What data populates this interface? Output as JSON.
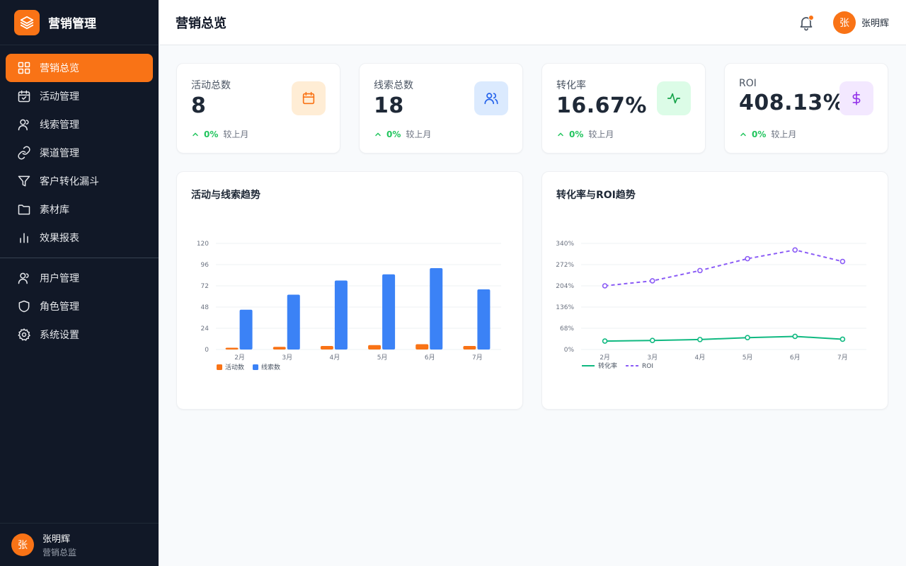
{
  "brand": {
    "name": "营销管理"
  },
  "sidebar": {
    "items": [
      {
        "label": "营销总览",
        "icon": "dashboard-icon",
        "active": true
      },
      {
        "label": "活动管理",
        "icon": "calendar-check-icon"
      },
      {
        "label": "线索管理",
        "icon": "user-icon"
      },
      {
        "label": "渠道管理",
        "icon": "link-icon"
      },
      {
        "label": "客户转化漏斗",
        "icon": "funnel-icon"
      },
      {
        "label": "素材库",
        "icon": "folder-icon"
      },
      {
        "label": "效果报表",
        "icon": "bar-chart-icon"
      }
    ],
    "admin_items": [
      {
        "label": "用户管理",
        "icon": "user-manage-icon"
      },
      {
        "label": "角色管理",
        "icon": "shield-icon"
      },
      {
        "label": "系统设置",
        "icon": "gear-icon"
      }
    ],
    "user": {
      "avatar": "张",
      "name": "张明辉",
      "role": "营销总监"
    }
  },
  "header": {
    "title": "营销总览",
    "user": {
      "avatar": "张",
      "name": "张明辉"
    }
  },
  "stats": [
    {
      "label": "活动总数",
      "value": "8",
      "change": "0%",
      "compare": "较上月",
      "icon": "calendar-icon",
      "icon_color": "#f97316",
      "icon_bg": "#ffedd5"
    },
    {
      "label": "线索总数",
      "value": "18",
      "change": "0%",
      "compare": "较上月",
      "icon": "users-icon",
      "icon_color": "#2563eb",
      "icon_bg": "#dbeafe"
    },
    {
      "label": "转化率",
      "value": "16.67%",
      "change": "0%",
      "compare": "较上月",
      "icon": "activity-icon",
      "icon_color": "#16a34a",
      "icon_bg": "#dcfce7"
    },
    {
      "label": "ROI",
      "value": "408.13%",
      "change": "0%",
      "compare": "较上月",
      "icon": "dollar-icon",
      "icon_color": "#9333ea",
      "icon_bg": "#f3e8ff"
    }
  ],
  "colors": {
    "accent": "#f97316",
    "sidebar_bg": "#111827",
    "positive": "#22c55e"
  },
  "chart_data": [
    {
      "type": "bar",
      "title": "活动与线索趋势",
      "categories": [
        "2月",
        "3月",
        "4月",
        "5月",
        "6月",
        "7月"
      ],
      "series": [
        {
          "name": "活动数",
          "color": "#f97316",
          "values": [
            2,
            3,
            4,
            5,
            6,
            4
          ]
        },
        {
          "name": "线索数",
          "color": "#3b82f6",
          "values": [
            45,
            62,
            78,
            85,
            92,
            68
          ]
        }
      ],
      "yticks": [
        "0",
        "24",
        "48",
        "72",
        "96",
        "120"
      ],
      "ylim": [
        0,
        120
      ],
      "legend": "bottom-left"
    },
    {
      "type": "line",
      "title": "转化率与ROI趋势",
      "categories": [
        "2月",
        "3月",
        "4月",
        "5月",
        "6月",
        "7月"
      ],
      "series": [
        {
          "name": "转化率",
          "color": "#10b981",
          "dashed": false,
          "values": [
            27,
            29,
            32,
            38,
            42,
            33
          ]
        },
        {
          "name": "ROI",
          "color": "#8b5cf6",
          "dashed": true,
          "values": [
            204,
            220,
            253,
            291,
            319,
            282
          ]
        }
      ],
      "yticks": [
        "0%",
        "68%",
        "136%",
        "204%",
        "272%",
        "340%"
      ],
      "ylim": [
        0,
        340
      ],
      "legend": "bottom-left"
    }
  ]
}
